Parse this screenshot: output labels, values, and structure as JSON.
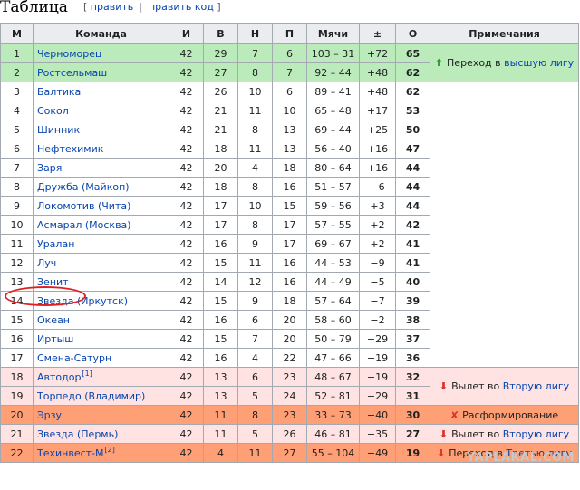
{
  "heading": {
    "title": "Таблица",
    "edit_open": "[",
    "edit": "править",
    "sep": "|",
    "edit_code": "править код",
    "edit_close": "]"
  },
  "columns": [
    "М",
    "Команда",
    "И",
    "В",
    "Н",
    "П",
    "Мячи",
    "±",
    "О",
    "Примечания"
  ],
  "rows": [
    {
      "pos": "1",
      "team": "Черноморец",
      "sup": "",
      "p": "42",
      "w": "29",
      "d": "7",
      "l": "6",
      "goals": "103 – 31",
      "gd": "+72",
      "pts": "65",
      "zone": "promo"
    },
    {
      "pos": "2",
      "team": "Ростсельмаш",
      "sup": "",
      "p": "42",
      "w": "27",
      "d": "8",
      "l": "7",
      "goals": "92 – 44",
      "gd": "+48",
      "pts": "62",
      "zone": "promo"
    },
    {
      "pos": "3",
      "team": "Балтика",
      "sup": "",
      "p": "42",
      "w": "26",
      "d": "10",
      "l": "6",
      "goals": "89 – 41",
      "gd": "+48",
      "pts": "62",
      "zone": "std"
    },
    {
      "pos": "4",
      "team": "Сокол",
      "sup": "",
      "p": "42",
      "w": "21",
      "d": "11",
      "l": "10",
      "goals": "65 – 48",
      "gd": "+17",
      "pts": "53",
      "zone": "std"
    },
    {
      "pos": "5",
      "team": "Шинник",
      "sup": "",
      "p": "42",
      "w": "21",
      "d": "8",
      "l": "13",
      "goals": "69 – 44",
      "gd": "+25",
      "pts": "50",
      "zone": "std"
    },
    {
      "pos": "6",
      "team": "Нефтехимик",
      "sup": "",
      "p": "42",
      "w": "18",
      "d": "11",
      "l": "13",
      "goals": "56 – 40",
      "gd": "+16",
      "pts": "47",
      "zone": "std"
    },
    {
      "pos": "7",
      "team": "Заря",
      "sup": "",
      "p": "42",
      "w": "20",
      "d": "4",
      "l": "18",
      "goals": "80 – 64",
      "gd": "+16",
      "pts": "44",
      "zone": "std"
    },
    {
      "pos": "8",
      "team": "Дружба (Майкоп)",
      "sup": "",
      "p": "42",
      "w": "18",
      "d": "8",
      "l": "16",
      "goals": "51 – 57",
      "gd": "−6",
      "pts": "44",
      "zone": "std"
    },
    {
      "pos": "9",
      "team": "Локомотив (Чита)",
      "sup": "",
      "p": "42",
      "w": "17",
      "d": "10",
      "l": "15",
      "goals": "59 – 56",
      "gd": "+3",
      "pts": "44",
      "zone": "std"
    },
    {
      "pos": "10",
      "team": "Асмарал (Москва)",
      "sup": "",
      "p": "42",
      "w": "17",
      "d": "8",
      "l": "17",
      "goals": "57 – 55",
      "gd": "+2",
      "pts": "42",
      "zone": "std"
    },
    {
      "pos": "11",
      "team": "Уралан",
      "sup": "",
      "p": "42",
      "w": "16",
      "d": "9",
      "l": "17",
      "goals": "69 – 67",
      "gd": "+2",
      "pts": "41",
      "zone": "std"
    },
    {
      "pos": "12",
      "team": "Луч",
      "sup": "",
      "p": "42",
      "w": "15",
      "d": "11",
      "l": "16",
      "goals": "44 – 53",
      "gd": "−9",
      "pts": "41",
      "zone": "std"
    },
    {
      "pos": "13",
      "team": "Зенит",
      "sup": "",
      "p": "42",
      "w": "14",
      "d": "12",
      "l": "16",
      "goals": "44 – 49",
      "gd": "−5",
      "pts": "40",
      "zone": "std"
    },
    {
      "pos": "14",
      "team": "Звезда (Иркутск)",
      "sup": "",
      "p": "42",
      "w": "15",
      "d": "9",
      "l": "18",
      "goals": "57 – 64",
      "gd": "−7",
      "pts": "39",
      "zone": "std"
    },
    {
      "pos": "15",
      "team": "Океан",
      "sup": "",
      "p": "42",
      "w": "16",
      "d": "6",
      "l": "20",
      "goals": "58 – 60",
      "gd": "−2",
      "pts": "38",
      "zone": "std"
    },
    {
      "pos": "16",
      "team": "Иртыш",
      "sup": "",
      "p": "42",
      "w": "15",
      "d": "7",
      "l": "20",
      "goals": "50 – 79",
      "gd": "−29",
      "pts": "37",
      "zone": "std"
    },
    {
      "pos": "17",
      "team": "Смена-Сатурн",
      "sup": "",
      "p": "42",
      "w": "16",
      "d": "4",
      "l": "22",
      "goals": "47 – 66",
      "gd": "−19",
      "pts": "36",
      "zone": "std"
    },
    {
      "pos": "18",
      "team": "Автодор",
      "sup": "[1]",
      "p": "42",
      "w": "13",
      "d": "6",
      "l": "23",
      "goals": "48 – 67",
      "gd": "−19",
      "pts": "32",
      "zone": "relg"
    },
    {
      "pos": "19",
      "team": "Торпедо (Владимир)",
      "sup": "",
      "p": "42",
      "w": "13",
      "d": "5",
      "l": "24",
      "goals": "52 – 81",
      "gd": "−29",
      "pts": "31",
      "zone": "relg"
    },
    {
      "pos": "20",
      "team": "Эрзу",
      "sup": "",
      "p": "42",
      "w": "11",
      "d": "8",
      "l": "23",
      "goals": "33 – 73",
      "gd": "−40",
      "pts": "30",
      "zone": "dis"
    },
    {
      "pos": "21",
      "team": "Звезда (Пермь)",
      "sup": "",
      "p": "42",
      "w": "11",
      "d": "5",
      "l": "26",
      "goals": "46 – 81",
      "gd": "−35",
      "pts": "27",
      "zone": "relg"
    },
    {
      "pos": "22",
      "team": "Техинвест-М",
      "sup": "[2]",
      "p": "42",
      "w": "4",
      "d": "11",
      "l": "27",
      "goals": "55 – 104",
      "gd": "−49",
      "pts": "19",
      "zone": "dis"
    }
  ],
  "notes": {
    "promo": {
      "arrow": "⬆",
      "text": "Переход в ",
      "link": "высшую лигу"
    },
    "relg": {
      "arrow": "⬇",
      "text": "Вылет во ",
      "link": "Вторую лигу"
    },
    "dis": {
      "arrow": "✘",
      "text": "Расформирование",
      "link": ""
    },
    "relg2": {
      "arrow": "⬇",
      "text": "Вылет во ",
      "link": "Вторую лигу"
    },
    "dis2": {
      "arrow": "⬇",
      "text": "Переход в ",
      "link": "Третью лигу"
    }
  },
  "watermark": "YAPLAKAL.COM",
  "colors": {
    "promo": "#bbebbb",
    "relegation": "#ffe3e3",
    "dissolved": "#ff9f75",
    "header": "#eaecf0",
    "link": "#0645ad",
    "annotation": "#e02020"
  }
}
